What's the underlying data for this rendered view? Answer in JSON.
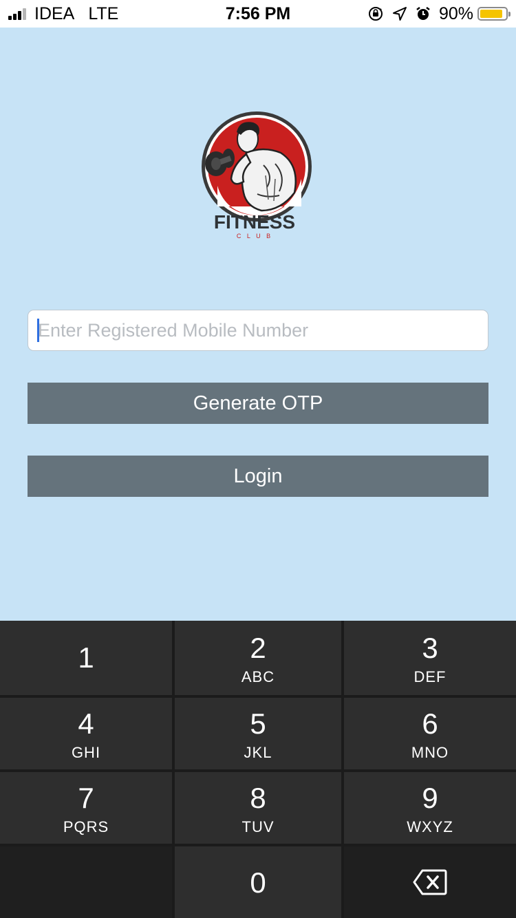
{
  "status_bar": {
    "carrier": "IDEA",
    "network": "LTE",
    "time": "7:56 PM",
    "battery_percent": "90%",
    "battery_level": 0.9,
    "icons": [
      "orientation-lock-icon",
      "location-arrow-icon",
      "alarm-icon"
    ]
  },
  "logo": {
    "title": "FITNESS",
    "subtitle": "C L U B",
    "accent_color": "#c9201f"
  },
  "form": {
    "mobile_placeholder": "Enter Registered Mobile Number",
    "mobile_value": "",
    "generate_otp_label": "Generate OTP",
    "login_label": "Login"
  },
  "keypad": {
    "keys": [
      {
        "digit": "1",
        "letters": ""
      },
      {
        "digit": "2",
        "letters": "ABC"
      },
      {
        "digit": "3",
        "letters": "DEF"
      },
      {
        "digit": "4",
        "letters": "GHI"
      },
      {
        "digit": "5",
        "letters": "JKL"
      },
      {
        "digit": "6",
        "letters": "MNO"
      },
      {
        "digit": "7",
        "letters": "PQRS"
      },
      {
        "digit": "8",
        "letters": "TUV"
      },
      {
        "digit": "9",
        "letters": "WXYZ"
      },
      {
        "digit": "0",
        "letters": ""
      }
    ],
    "delete_icon": "backspace-icon"
  },
  "colors": {
    "background": "#c7e3f6",
    "button": "#65737c",
    "keypad": "#2e2e2e"
  }
}
